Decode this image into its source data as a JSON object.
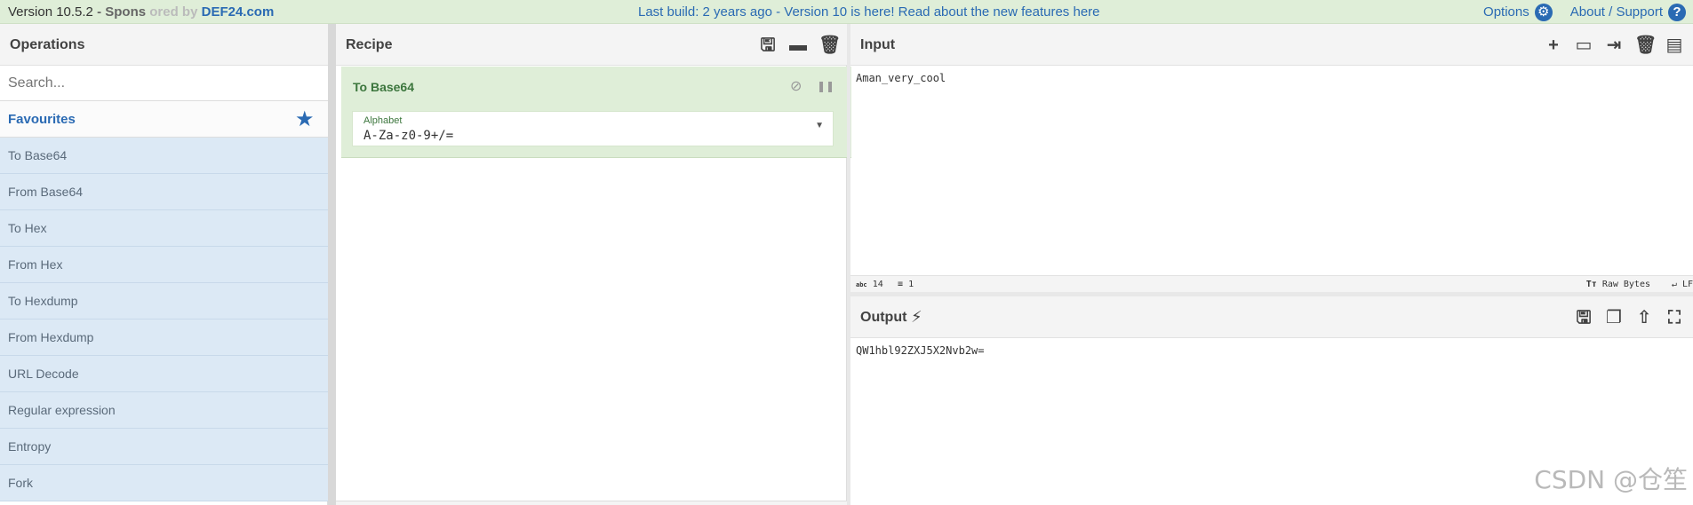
{
  "banner": {
    "version": "Version 10.5.2",
    "sponsor_prefix": "- Spons",
    "sponsor_mid": "ored by",
    "sponsor": "DEF24.com",
    "notice": "Last build: 2 years ago - Version 10 is here! Read about the new features here",
    "options": "Options",
    "about": "About / Support"
  },
  "operations": {
    "title": "Operations",
    "search_placeholder": "Search...",
    "favourites": "Favourites",
    "items": [
      "To Base64",
      "From Base64",
      "To Hex",
      "From Hex",
      "To Hexdump",
      "From Hexdump",
      "URL Decode",
      "Regular expression",
      "Entropy",
      "Fork"
    ]
  },
  "recipe": {
    "title": "Recipe",
    "operation": "To Base64",
    "alphabet_label": "Alphabet",
    "alphabet_value": "A-Za-z0-9+/="
  },
  "input": {
    "title": "Input",
    "text": "Aman_very_cool",
    "chars_label": "abc",
    "chars": "14",
    "lines": "1",
    "encoding": "Raw Bytes",
    "eol": "LF"
  },
  "output": {
    "title": "Output",
    "text": "QW1hbl92ZXJ5X2Nvb2w="
  },
  "watermark": "CSDN @仓笙"
}
